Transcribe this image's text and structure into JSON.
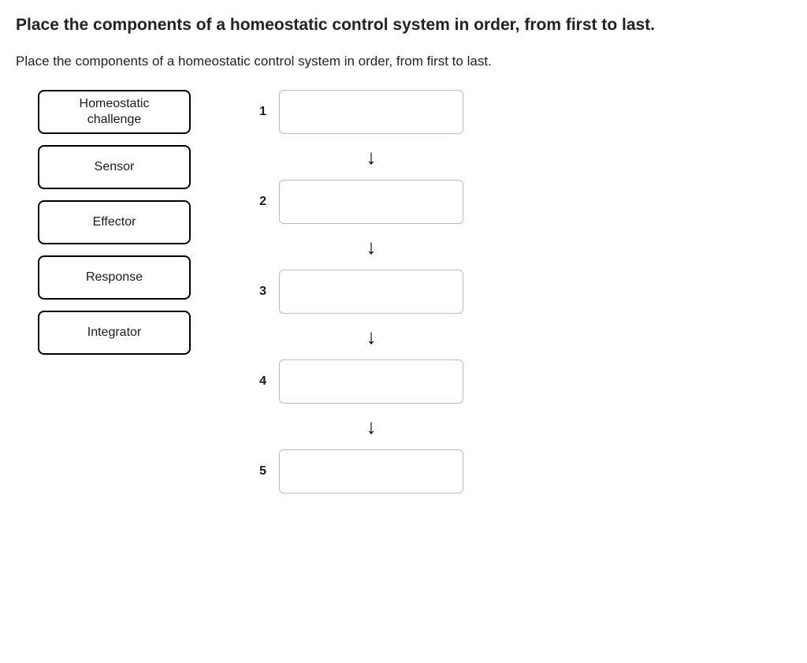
{
  "title": "Place the components of a homeostatic control system in order, from first to last.",
  "subtitle": "Place the components of a homeostatic control system in order, from first to last.",
  "items": [
    {
      "label": "Homeostatic\nchallenge"
    },
    {
      "label": "Sensor"
    },
    {
      "label": "Effector"
    },
    {
      "label": "Response"
    },
    {
      "label": "Integrator"
    }
  ],
  "slots": [
    {
      "number": "1"
    },
    {
      "number": "2"
    },
    {
      "number": "3"
    },
    {
      "number": "4"
    },
    {
      "number": "5"
    }
  ],
  "arrow": "↓"
}
